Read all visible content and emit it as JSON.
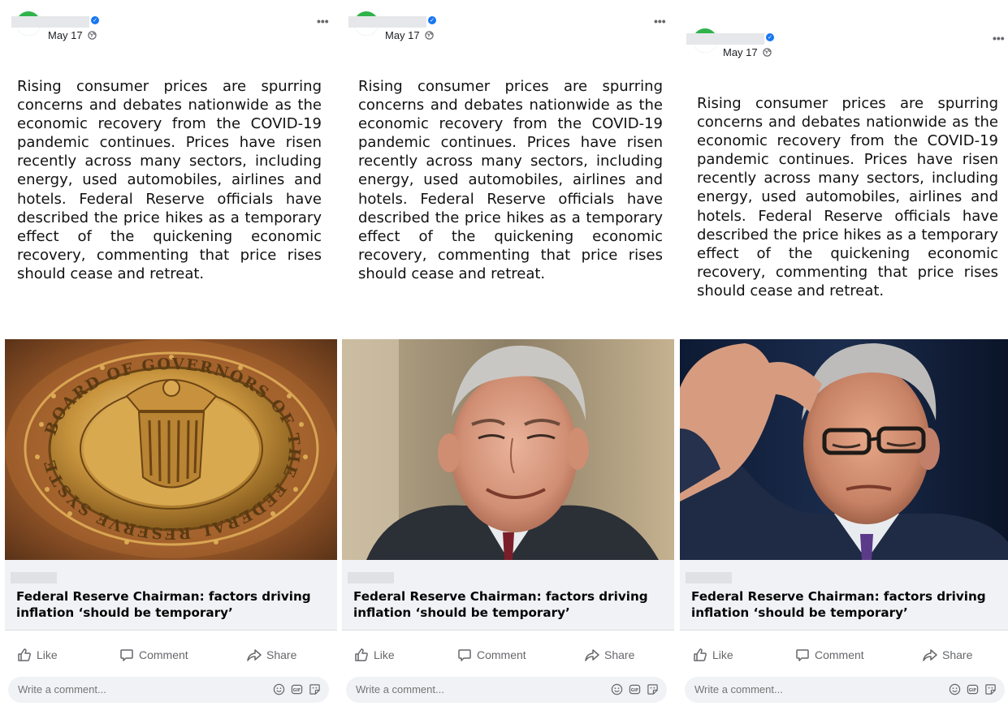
{
  "posts": [
    {
      "date": "May 17",
      "more_label": "•••",
      "body": "Rising consumer prices are spurring concerns and debates nationwide as the economic recovery from the COVID-19 pandemic continues. Prices have risen recently across many sectors, including energy, used automobiles, airlines and hotels. Federal Reserve officials have described the price hikes as a temporary effect of the quickening economic recovery, commenting that price rises should cease and retreat.",
      "image_text": "BOARD OF GOVERNORS OF THE FEDERAL RESERVE SYSTEM",
      "link_title": "Federal Reserve Chairman: factors driving inflation ‘should be temporary’",
      "actions": {
        "like": "Like",
        "comment": "Comment",
        "share": "Share"
      },
      "comment_placeholder": "Write a comment..."
    },
    {
      "date": "May 17",
      "more_label": "•••",
      "body": "Rising consumer prices are spurring concerns and debates nationwide as the economic recovery from the COVID-19 pandemic continues. Prices have risen recently across many sectors, including energy, used automobiles, airlines and hotels. Federal Reserve officials have described the price hikes as a temporary effect of the quickening economic recovery, commenting that price rises should cease and retreat.",
      "link_title": "Federal Reserve Chairman: factors driving inflation ‘should be temporary’",
      "actions": {
        "like": "Like",
        "comment": "Comment",
        "share": "Share"
      },
      "comment_placeholder": "Write a comment..."
    },
    {
      "date": "May 17",
      "more_label": "•••",
      "body": "Rising consumer prices are spurring concerns and debates nationwide as the economic recovery from the COVID-19 pandemic continues. Prices have risen recently across many sectors, including energy, used automobiles, airlines and hotels. Federal Reserve officials have described the price hikes as a temporary effect of the quickening economic recovery, commenting that price rises should cease and retreat.",
      "link_title": "Federal Reserve Chairman: factors driving inflation ‘should be temporary’",
      "actions": {
        "like": "Like",
        "comment": "Comment",
        "share": "Share"
      },
      "comment_placeholder": "Write a comment..."
    }
  ],
  "icons": {
    "verified": "verified-badge-icon",
    "privacy": "globe-icon",
    "like": "thumbs-up-icon",
    "comment": "speech-bubble-icon",
    "share": "share-arrow-icon",
    "emoji": "smiley-icon",
    "gif": "gif-icon",
    "sticker": "sticker-icon"
  },
  "colors": {
    "avatar": "#2fb34a",
    "verified": "#1877f2",
    "muted_text": "#65676b",
    "card_bg": "#f0f2f5"
  }
}
